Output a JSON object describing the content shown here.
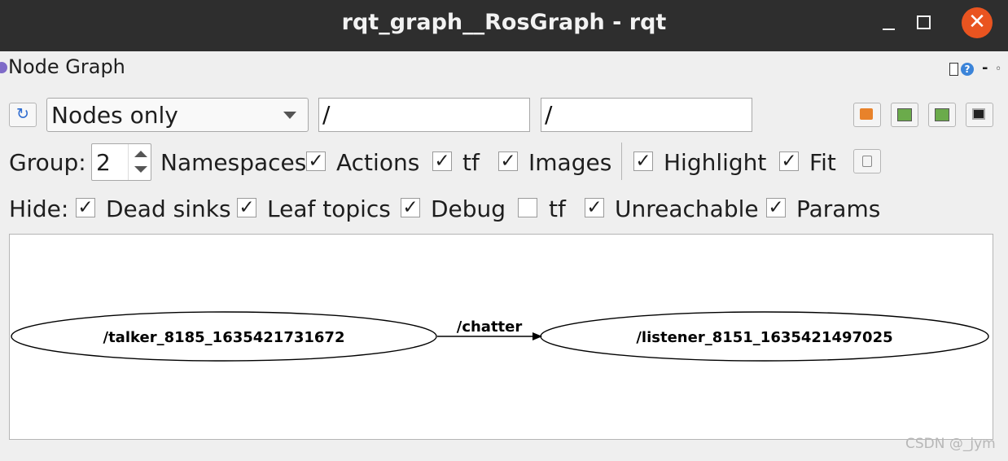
{
  "window": {
    "title": "rqt_graph__RosGraph - rqt",
    "close_glyph": "✕"
  },
  "plugin": {
    "title": "Node Graph",
    "help_glyph": "?",
    "minus_glyph": "-",
    "float_glyph": "◦"
  },
  "toolbar": {
    "refresh_glyph": "↻",
    "mode": "Nodes only",
    "node_filter": "/",
    "topic_filter": "/"
  },
  "options": {
    "group_label": "Group:",
    "group_value": "2",
    "namespaces": {
      "label": "Namespaces",
      "checked": true
    },
    "actions": {
      "label": "Actions",
      "checked": true
    },
    "tf": {
      "label": "tf",
      "checked": true
    },
    "images": {
      "label": "Images",
      "checked": false
    },
    "highlight": {
      "label": "Highlight",
      "checked": true
    },
    "fit": {
      "label": "Fit",
      "checked": true
    }
  },
  "hide": {
    "label": "Hide:",
    "dead_sinks": {
      "label": "Dead sinks",
      "checked": true
    },
    "leaf_topics": {
      "label": "Leaf topics",
      "checked": true
    },
    "debug": {
      "label": "Debug",
      "checked": true
    },
    "tf": {
      "label": "tf",
      "checked": false
    },
    "unreachable": {
      "label": "Unreachable",
      "checked": true
    },
    "params": {
      "label": "Params",
      "checked": true
    }
  },
  "graph": {
    "nodes": [
      {
        "label": "/talker_8185_1635421731672"
      },
      {
        "label": "/listener_8151_1635421497025"
      }
    ],
    "edges": [
      {
        "from": 0,
        "to": 1,
        "label": "/chatter"
      }
    ]
  },
  "watermark": "CSDN @_jym",
  "check_glyph": "✓"
}
